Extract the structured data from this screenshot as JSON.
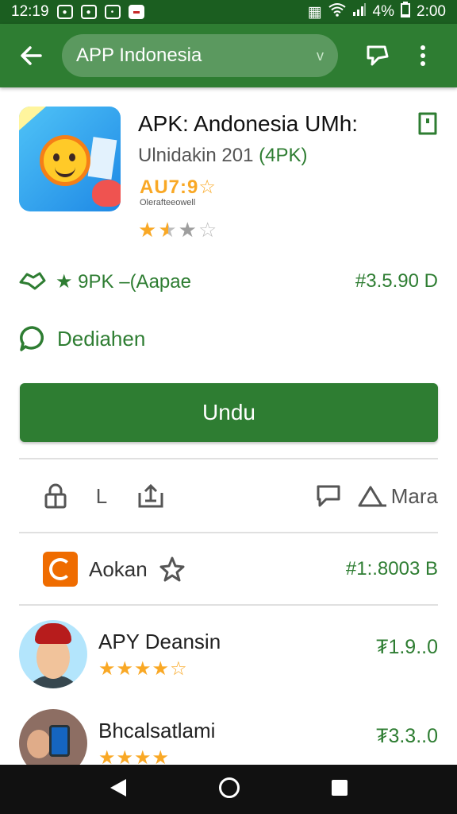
{
  "status_bar": {
    "time_left": "12:19",
    "battery_text": "4%",
    "time_right": "2:00"
  },
  "app_bar": {
    "search_text": "APP Indonesia",
    "dropdown_glyph": "v"
  },
  "app": {
    "title": "APK: Andonesia UMh:",
    "subtitle_main": "Ulnidakin 201 ",
    "subtitle_accent": "(4PK)",
    "age_badge": "AU7:9☆",
    "age_small": "Olerafteeowell",
    "rating_stars": [
      "full",
      "half",
      "grey",
      "empty"
    ]
  },
  "info": {
    "label": "★ 9PK –(Aapae",
    "value": "#3.5.90 D"
  },
  "developer": {
    "label": "Dediahen"
  },
  "install_button": {
    "label": "Undu"
  },
  "actions": {
    "letter": "L",
    "more_label": "Mara"
  },
  "section": {
    "label": "Aokan",
    "value": "#1:.8003 B"
  },
  "list": [
    {
      "name": "APY Deansin",
      "price": "₮1.9..0",
      "stars": "★★★★☆"
    },
    {
      "name": "Bhcalsatlami",
      "price": "₮3.3..0",
      "stars": "★★★★"
    }
  ],
  "colors": {
    "primary": "#2e7d32",
    "status_bar": "#1b5e20",
    "star": "#f9a825",
    "section_icon": "#ef6c00"
  }
}
